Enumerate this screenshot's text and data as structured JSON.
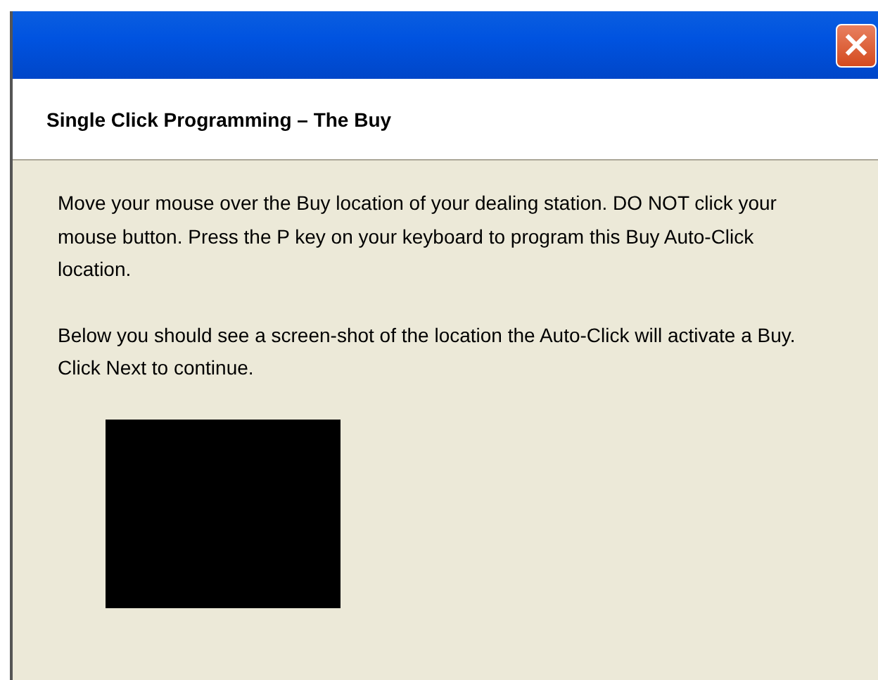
{
  "window": {
    "title_bar": {
      "close_button": "×"
    }
  },
  "header": {
    "title": "Single Click Programming – The Buy"
  },
  "body": {
    "paragraphs": [
      "Move your mouse over the Buy location of your dealing station. DO NOT click your mouse button. Press the P key on your keyboard to program this Buy Auto-Click location.",
      "Below you should see a screen-shot of the location the Auto-Click will activate a Buy. Click Next to continue."
    ]
  }
}
